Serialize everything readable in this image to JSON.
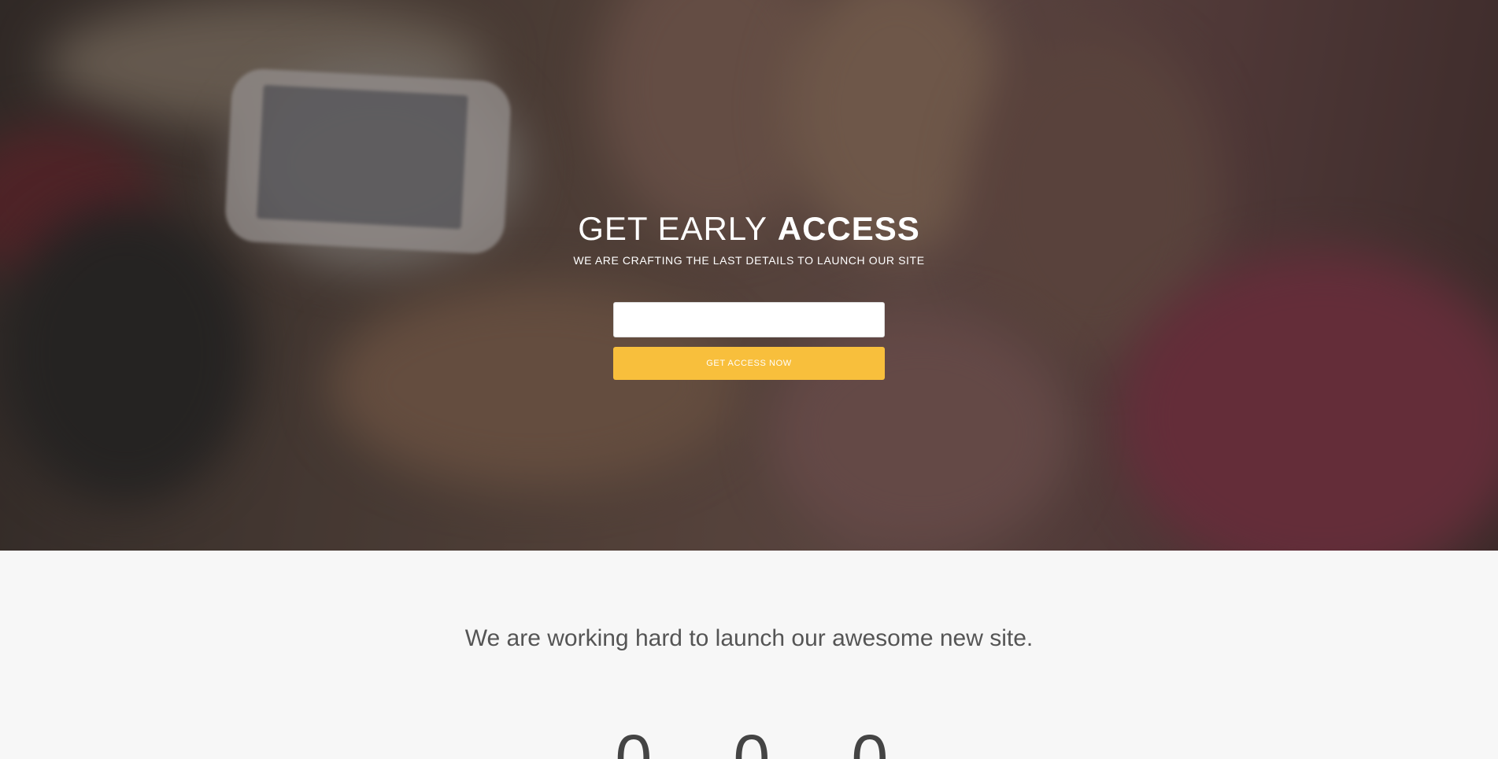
{
  "hero": {
    "headline_light": "GET EARLY",
    "headline_bold": "ACCESS",
    "subheadline": "WE ARE CRAFTING THE LAST DETAILS TO LAUNCH OUR SITE",
    "email_value": "",
    "email_placeholder": "",
    "button_label": "GET ACCESS NOW",
    "background_image_icon": "group-selfie-photo"
  },
  "lower": {
    "tagline": "We are working hard to launch our awesome new site.",
    "countdown": [
      "0",
      "0",
      "0"
    ]
  },
  "colors": {
    "accent": "#f8bf3c",
    "section_background": "#f7f7f7",
    "tagline_text": "#555555"
  }
}
